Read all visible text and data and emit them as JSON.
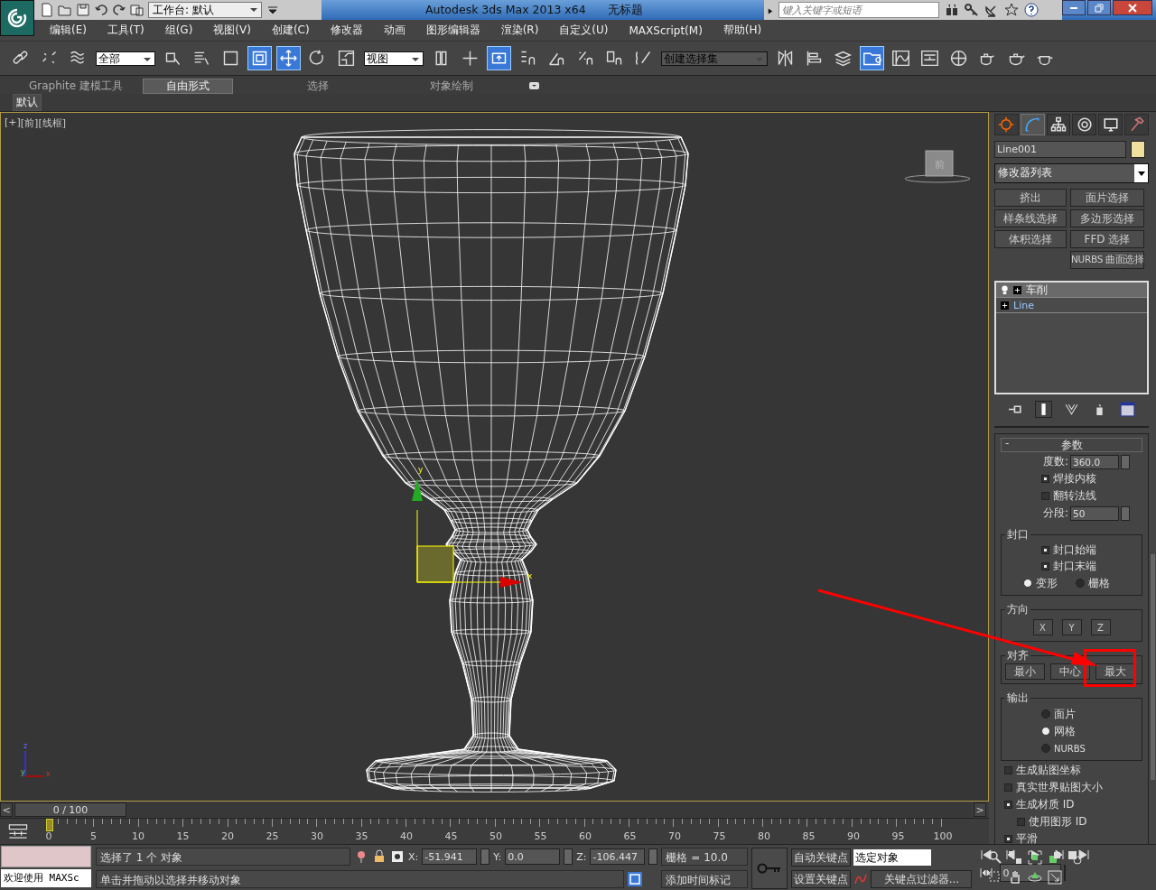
{
  "title_bar": {
    "workspace": "工作台: 默认",
    "title": "Autodesk 3ds Max  2013 x64",
    "document": "无标题",
    "search": {
      "placeholder": "键入关键字或短语"
    }
  },
  "menu": [
    "编辑(E)",
    "工具(T)",
    "组(G)",
    "视图(V)",
    "创建(C)",
    "修改器",
    "动画",
    "图形编辑器",
    "渲染(R)",
    "自定义(U)",
    "MAXScript(M)",
    "帮助(H)"
  ],
  "toolbar": [
    {
      "kind": "icon",
      "active": false
    },
    {
      "kind": "icon",
      "active": false
    },
    {
      "kind": "icon",
      "active": false
    },
    {
      "kind": "dropdown",
      "value": "全部"
    },
    {
      "kind": "icon",
      "active": false
    },
    {
      "kind": "icon",
      "active": false
    },
    {
      "kind": "icon",
      "active": false
    },
    {
      "kind": "icon",
      "active": true
    },
    {
      "kind": "icon",
      "active": true
    },
    {
      "kind": "icon",
      "active": false
    },
    {
      "kind": "icon",
      "active": false
    },
    {
      "kind": "dropdown",
      "value": "视图"
    },
    {
      "kind": "icon",
      "active": false
    },
    {
      "kind": "icon",
      "active": false
    },
    {
      "kind": "icon",
      "active": true
    },
    {
      "kind": "icon",
      "active": false
    },
    {
      "kind": "icon",
      "active": false
    },
    {
      "kind": "icon",
      "active": false
    },
    {
      "kind": "icon",
      "active": false
    },
    {
      "kind": "icon",
      "active": false
    },
    {
      "kind": "dropdown",
      "value": "创建选择集"
    },
    {
      "kind": "icon",
      "active": false
    },
    {
      "kind": "icon",
      "active": false
    },
    {
      "kind": "icon",
      "active": false
    },
    {
      "kind": "icon",
      "active": true
    },
    {
      "kind": "icon",
      "active": false
    },
    {
      "kind": "icon",
      "active": false
    },
    {
      "kind": "icon",
      "active": false
    },
    {
      "kind": "icon",
      "active": false
    },
    {
      "kind": "icon",
      "active": false
    },
    {
      "kind": "icon",
      "active": false
    }
  ],
  "ribbon": {
    "tabs": [
      {
        "label": "Graphite 建模工具",
        "selected": false
      },
      {
        "label": "自由形式",
        "selected": true
      },
      {
        "label": "选择",
        "selected": false
      },
      {
        "label": "对象绘制",
        "selected": false
      }
    ],
    "panel": "默认"
  },
  "viewport": {
    "labels": [
      "[+]",
      "[前]",
      "[线框]"
    ],
    "viewcube": "前",
    "gizmo": {
      "x": "x",
      "y": "y"
    },
    "tripod": {
      "z": "z",
      "y": "y",
      "x": "x"
    }
  },
  "command_panel": {
    "tabs": [
      {
        "selected": false
      },
      {
        "selected": true
      },
      {
        "selected": false
      },
      {
        "selected": false
      },
      {
        "selected": false
      },
      {
        "selected": false
      }
    ],
    "object_name": "Line001",
    "modifier_list": "修改器列表",
    "modifier_buttons": [
      {
        "label": "挤出"
      },
      {
        "label": "面片选择"
      },
      {
        "label": "样条线选择"
      },
      {
        "label": "多边形选择"
      },
      {
        "label": "体积选择"
      },
      {
        "label": "FFD 选择"
      },
      {
        "label": "NURBS 曲面选择"
      }
    ],
    "stack": [
      {
        "label": "车削",
        "kind": "modifier",
        "selected": true
      },
      {
        "label": "Line",
        "kind": "object",
        "selected": false
      }
    ],
    "parameters": {
      "title": "参数",
      "collapse": "-",
      "degrees": {
        "label": "度数:",
        "value": "360.0"
      },
      "weld_core": {
        "label": "焊接内核",
        "checked": true
      },
      "flip_normals": {
        "label": "翻转法线",
        "checked": false
      },
      "segments": {
        "label": "分段:",
        "value": "50"
      },
      "capping": {
        "title": "封口",
        "checks": [
          {
            "label": "封口始端",
            "checked": true
          },
          {
            "label": "封口末端",
            "checked": true
          }
        ],
        "options": [
          {
            "label": "变形",
            "selected": true
          },
          {
            "label": "栅格",
            "selected": false
          }
        ]
      },
      "direction": {
        "title": "方向",
        "buttons": [
          "X",
          "Y",
          "Z"
        ]
      },
      "align": {
        "title": "对齐",
        "buttons": [
          "最小",
          "中心",
          "最大"
        ]
      },
      "output": {
        "title": "输出",
        "options": [
          {
            "label": "面片",
            "selected": false
          },
          {
            "label": "网格",
            "selected": true
          },
          {
            "label": "NURBS",
            "selected": false
          }
        ]
      },
      "checks": [
        {
          "label": "生成贴图坐标",
          "checked": false
        },
        {
          "label": "真实世界贴图大小",
          "checked": false
        },
        {
          "label": "生成材质 ID",
          "checked": true
        },
        {
          "label": "使用图形 ID",
          "checked": false
        },
        {
          "label": "平滑",
          "checked": true
        }
      ]
    }
  },
  "timeline": {
    "frame": "0 / 100",
    "prev": "<",
    "next": ">",
    "ticks": [
      "0",
      "5",
      "10",
      "15",
      "20",
      "25",
      "30",
      "35",
      "40",
      "45",
      "50",
      "55",
      "60",
      "65",
      "70",
      "75",
      "80",
      "85",
      "90",
      "95",
      "100"
    ]
  },
  "status": {
    "listener": "欢迎使用 MAXSc",
    "selection": "选择了 1 个 对象",
    "prompt": "单击并拖动以选择并移动对象",
    "coords": [
      {
        "label": "X:",
        "value": "-51.941"
      },
      {
        "label": "Y:",
        "value": "0.0"
      },
      {
        "label": "Z:",
        "value": "-106.447"
      }
    ],
    "grid": "栅格 = 10.0",
    "add_time_tag": "添加时间标记",
    "auto_key": "自动关键点",
    "set_key": "设置关键点",
    "key_mode": "选定对象",
    "key_filters": "关键点过滤器...",
    "current_frame": "0"
  }
}
